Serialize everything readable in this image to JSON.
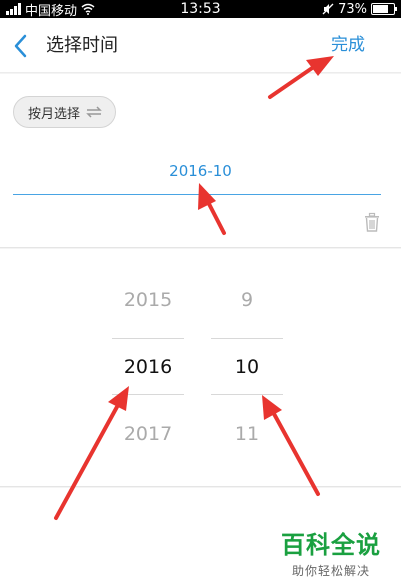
{
  "status_bar": {
    "carrier": "中国移动",
    "time": "13:53",
    "battery": "73%",
    "battery_level": 0.73
  },
  "header": {
    "title": "选择时间",
    "done_label": "完成"
  },
  "mode_toggle": {
    "label": "按月选择"
  },
  "selected_value": "2016-10",
  "picker": {
    "years": [
      "2015",
      "2016",
      "2017"
    ],
    "months": [
      "9",
      "10",
      "11"
    ]
  },
  "watermark": {
    "title": "百科全说",
    "subtitle": "助你轻松解决"
  },
  "colors": {
    "accent": "#2a8fd8",
    "annotation_arrow": "#e8342f",
    "watermark_green": "#1aa040"
  },
  "icons": {
    "back": "chevron-left-icon",
    "swap": "swap-arrows-icon",
    "delete": "trash-icon",
    "wifi": "wifi-icon",
    "mute": "mute-icon",
    "battery": "battery-icon"
  }
}
